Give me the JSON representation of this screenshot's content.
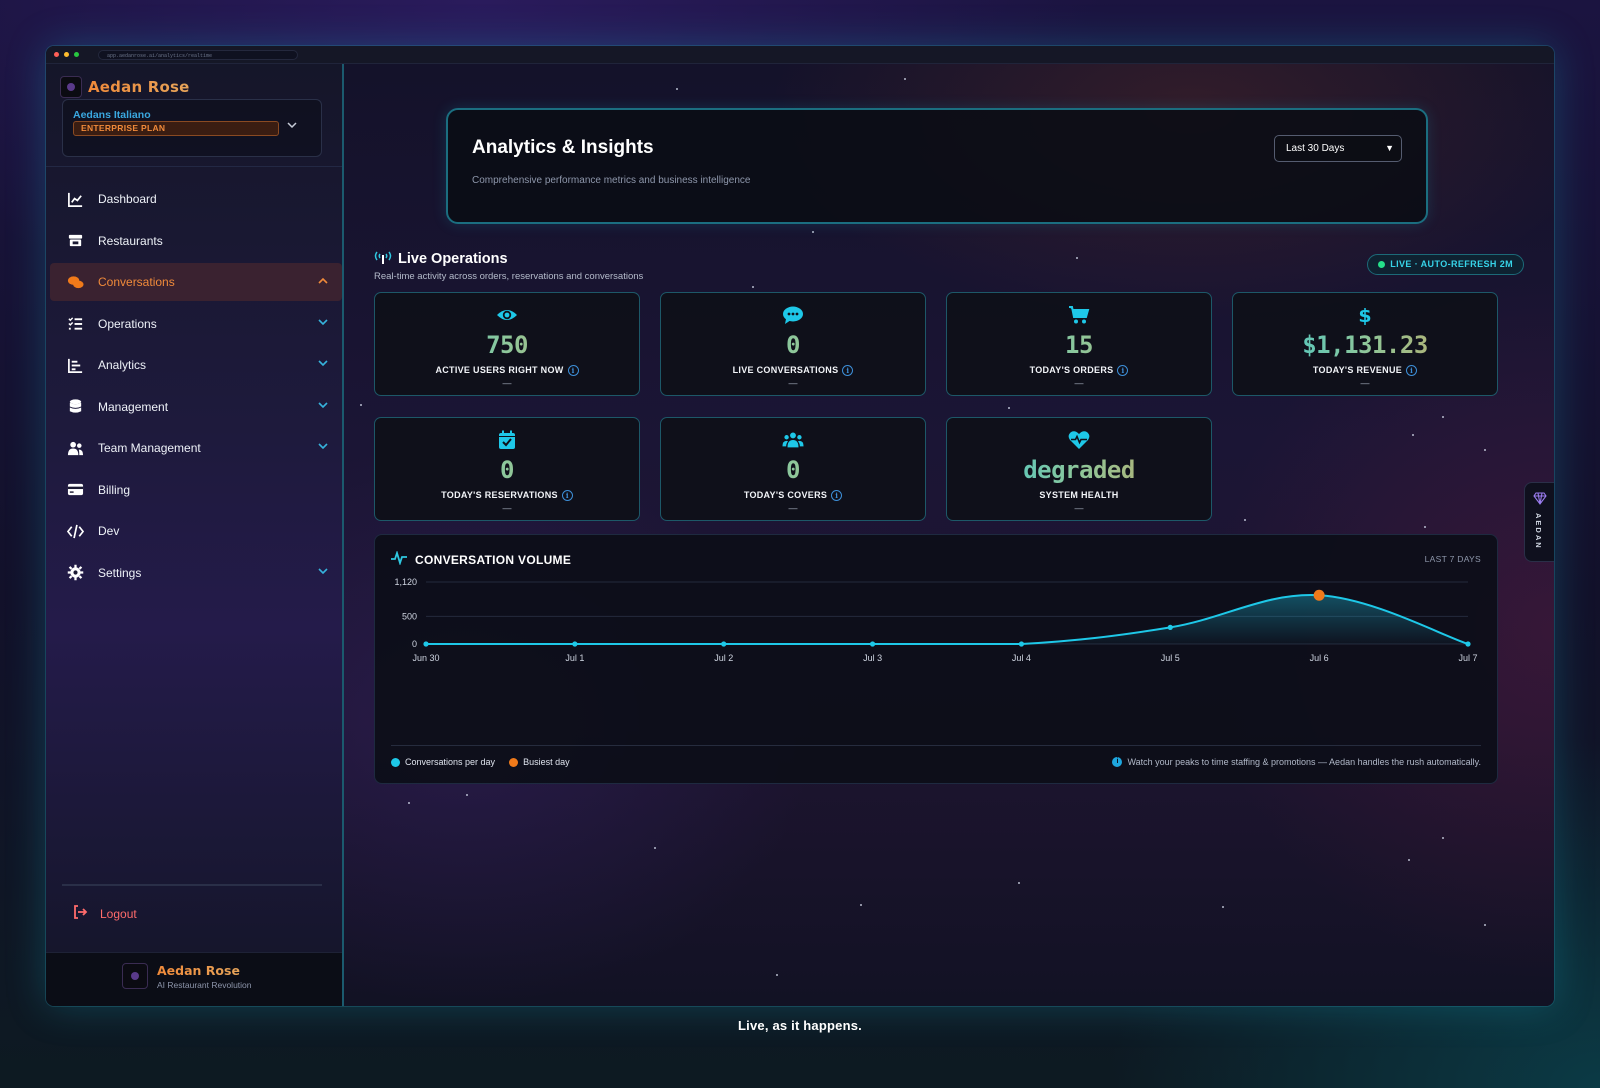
{
  "browser": {
    "url": "app.aedanrose.ai/analytics/realtime"
  },
  "brand": {
    "name": "Aedan Rose",
    "tagline": "AI Restaurant Revolution"
  },
  "org": {
    "name": "Aedans Italiano",
    "plan": "ENTERPRISE PLAN"
  },
  "nav": [
    {
      "label": "Dashboard",
      "icon": "chart-line-icon",
      "has_chevron": false,
      "active": false
    },
    {
      "label": "Restaurants",
      "icon": "store-icon",
      "has_chevron": false,
      "active": false
    },
    {
      "label": "Conversations",
      "icon": "chat-bubbles-icon",
      "has_chevron": true,
      "active": true,
      "expanded": true
    },
    {
      "label": "Operations",
      "icon": "list-check-icon",
      "has_chevron": true,
      "active": false
    },
    {
      "label": "Analytics",
      "icon": "bar-chart-icon",
      "has_chevron": true,
      "active": false
    },
    {
      "label": "Management",
      "icon": "database-icon",
      "has_chevron": true,
      "active": false
    },
    {
      "label": "Team Management",
      "icon": "users-icon",
      "has_chevron": true,
      "active": false
    },
    {
      "label": "Billing",
      "icon": "credit-card-icon",
      "has_chevron": false,
      "active": false
    },
    {
      "label": "Dev",
      "icon": "code-icon",
      "has_chevron": false,
      "active": false
    },
    {
      "label": "Settings",
      "icon": "gear-icon",
      "has_chevron": true,
      "active": false
    }
  ],
  "logout": {
    "label": "Logout"
  },
  "hero": {
    "title": "Analytics & Insights",
    "subtitle": "Comprehensive performance metrics and business intelligence",
    "range_selected": "Last 30 Days"
  },
  "live_ops": {
    "title": "Live Operations",
    "subtitle": "Real-time activity across orders, reservations and conversations",
    "status_pill": "LIVE · AUTO-REFRESH 2M",
    "cards": [
      {
        "label": "ACTIVE USERS RIGHT NOW",
        "value": "750",
        "sub": "—",
        "icon": "eye-icon",
        "info": true
      },
      {
        "label": "LIVE CONVERSATIONS",
        "value": "0",
        "sub": "—",
        "icon": "chat-icon",
        "info": true
      },
      {
        "label": "TODAY'S ORDERS",
        "value": "15",
        "sub": "—",
        "icon": "cart-icon",
        "info": true
      },
      {
        "label": "TODAY'S REVENUE",
        "value": "$1,131.23",
        "sub": "—",
        "icon": "dollar-icon",
        "info": true
      },
      {
        "label": "TODAY'S RESERVATIONS",
        "value": "0",
        "sub": "—",
        "icon": "calendar-check-icon",
        "info": true
      },
      {
        "label": "TODAY'S COVERS",
        "value": "0",
        "sub": "—",
        "icon": "people-icon",
        "info": true
      },
      {
        "label": "SYSTEM HEALTH",
        "value": "degraded",
        "sub": "—",
        "icon": "heart-pulse-icon",
        "info": false
      }
    ]
  },
  "chart_panel": {
    "title": "CONVERSATION VOLUME",
    "range": "LAST 7 DAYS",
    "legend": [
      {
        "name": "Conversations per day",
        "color": "#1ec8e8"
      },
      {
        "name": "Busiest day",
        "color": "#f07a1a"
      }
    ],
    "note": "Watch your peaks to time staffing & promotions — Aedan handles the rush automatically."
  },
  "chart_data": {
    "type": "area",
    "title": "CONVERSATION VOLUME",
    "categories": [
      "Jun 30",
      "Jul 1",
      "Jul 2",
      "Jul 3",
      "Jul 4",
      "Jul 5",
      "Jul 6",
      "Jul 7"
    ],
    "series": [
      {
        "name": "Conversations per day",
        "values": [
          0,
          0,
          0,
          0,
          0,
          300,
          880,
          0
        ]
      }
    ],
    "highlight": {
      "name": "Busiest day",
      "category": "Jul 6",
      "value": 880
    },
    "y_ticks": [
      "1,120",
      "500",
      "0"
    ],
    "ylim": [
      0,
      1120
    ],
    "grid": true,
    "legend_position": "bottom-left",
    "colors": {
      "line": "#1ec8e8",
      "busiest": "#f07a1a"
    }
  },
  "side_tab": {
    "label": "AEDAN"
  },
  "caption": "Live, as it happens.",
  "colors": {
    "accent": "#1ec8e8",
    "brand": "#f08a3a",
    "danger": "#ff6b6b"
  }
}
